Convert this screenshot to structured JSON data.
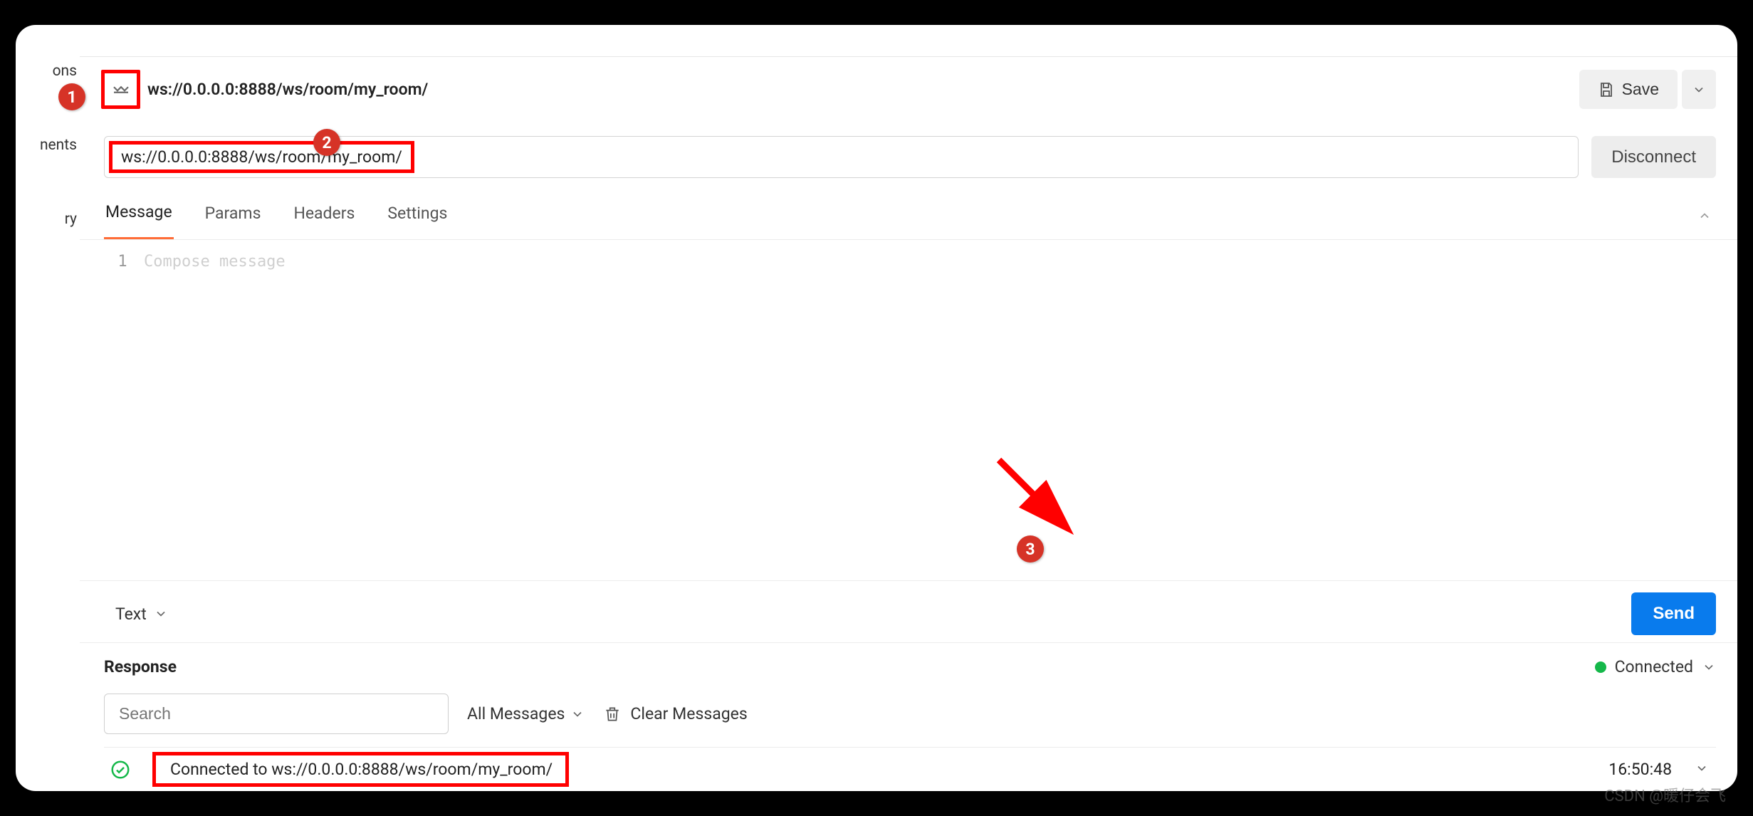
{
  "sidebar": {
    "items": [
      {
        "label": "ons"
      },
      {
        "label": "nents"
      },
      {
        "label": "ry"
      }
    ]
  },
  "header": {
    "url_title": "ws://0.0.0.0:8888/ws/room/my_room/",
    "save_label": "Save"
  },
  "annotations": {
    "bubble1": "1",
    "bubble2": "2",
    "bubble3": "3"
  },
  "connection": {
    "url": "ws://0.0.0.0:8888/ws/room/my_room/",
    "disconnect_label": "Disconnect"
  },
  "tabs": {
    "items": [
      {
        "label": "Message"
      },
      {
        "label": "Params"
      },
      {
        "label": "Headers"
      },
      {
        "label": "Settings"
      }
    ],
    "active_index": 0
  },
  "compose": {
    "line_num": "1",
    "placeholder": "Compose message",
    "format": "Text",
    "send_label": "Send"
  },
  "response": {
    "title": "Response",
    "status_label": "Connected",
    "search_placeholder": "Search",
    "filter_label": "All Messages",
    "clear_label": "Clear Messages",
    "messages": [
      {
        "text": "Connected to ws://0.0.0.0:8888/ws/room/my_room/",
        "time": "16:50:48"
      }
    ]
  },
  "watermark": "CSDN @暖仔会飞"
}
